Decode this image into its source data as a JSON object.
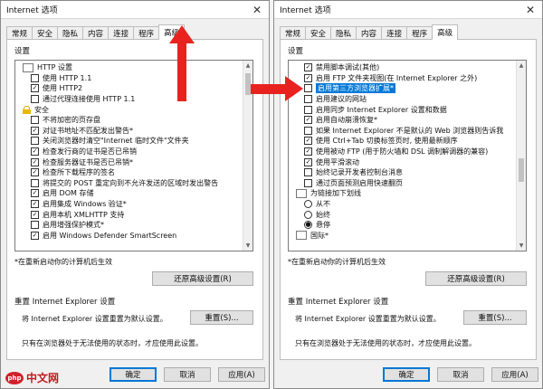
{
  "watermark": {
    "logo": "php",
    "text": "中文网"
  },
  "left": {
    "title": "Internet 选项",
    "tabs": [
      "常规",
      "安全",
      "隐私",
      "内容",
      "连接",
      "程序",
      "高级"
    ],
    "active_tab": 6,
    "settings_label": "设置",
    "rows": [
      {
        "type": "folder",
        "label": "HTTP 设置"
      },
      {
        "type": "check",
        "checked": false,
        "label": "使用 HTTP 1.1"
      },
      {
        "type": "check",
        "checked": true,
        "label": "使用 HTTP2"
      },
      {
        "type": "check",
        "checked": false,
        "label": "通过代理连接使用 HTTP 1.1"
      },
      {
        "type": "lock",
        "label": "安全"
      },
      {
        "type": "check",
        "checked": false,
        "label": "不将加密的页存盘"
      },
      {
        "type": "check",
        "checked": true,
        "label": "对证书地址不匹配发出警告*"
      },
      {
        "type": "check",
        "checked": false,
        "label": "关闭浏览器时清空\"Internet 临时文件\"文件夹"
      },
      {
        "type": "check",
        "checked": true,
        "label": "检查发行商的证书是否已吊销"
      },
      {
        "type": "check",
        "checked": true,
        "label": "检查服务器证书是否已吊销*"
      },
      {
        "type": "check",
        "checked": true,
        "label": "检查所下载程序的签名"
      },
      {
        "type": "check",
        "checked": false,
        "label": "将提交的 POST 重定向到不允许发送的区域时发出警告"
      },
      {
        "type": "check",
        "checked": true,
        "label": "启用 DOM 存储"
      },
      {
        "type": "check",
        "checked": true,
        "label": "启用集成 Windows 验证*"
      },
      {
        "type": "check",
        "checked": true,
        "label": "启用本机 XMLHTTP 支持"
      },
      {
        "type": "check",
        "checked": false,
        "label": "启用增强保护模式*"
      },
      {
        "type": "check",
        "checked": true,
        "label": "启用 Windows Defender SmartScreen"
      }
    ],
    "restart_note": "*在重新启动你的计算机后生效",
    "restore_button": "还原高级设置(R)",
    "reset_group_title": "重置 Internet Explorer 设置",
    "reset_desc": "将 Internet Explorer 设置重置为默认设置。",
    "reset_button": "重置(S)...",
    "reset_note": "只有在浏览器处于无法使用的状态时，才应使用此设置。",
    "ok": "确定",
    "cancel": "取消",
    "apply": "应用(A)"
  },
  "right": {
    "title": "Internet 选项",
    "tabs": [
      "常规",
      "安全",
      "隐私",
      "内容",
      "连接",
      "程序",
      "高级"
    ],
    "active_tab": 6,
    "settings_label": "设置",
    "rows": [
      {
        "type": "check",
        "checked": true,
        "label": "禁用脚本调试(其他)"
      },
      {
        "type": "check",
        "checked": true,
        "label": "启用 FTP 文件夹视图(在 Internet Explorer 之外)"
      },
      {
        "type": "check",
        "checked": false,
        "label": "启用第三方浏览器扩展*",
        "highlight": true
      },
      {
        "type": "check",
        "checked": false,
        "label": "启用建议的网站"
      },
      {
        "type": "check",
        "checked": false,
        "label": "启用同步 Internet Explorer 设置和数据"
      },
      {
        "type": "check",
        "checked": true,
        "label": "启用自动崩溃恢复*"
      },
      {
        "type": "check",
        "checked": false,
        "label": "如果 Internet Explorer 不是默认的 Web 浏览器则告诉我"
      },
      {
        "type": "check",
        "checked": true,
        "label": "使用 Ctrl+Tab 切换标签页时, 使用最新顺序"
      },
      {
        "type": "check",
        "checked": true,
        "label": "使用被动 FTP (用于防火墙和 DSL 调制解调器的兼容)"
      },
      {
        "type": "check",
        "checked": true,
        "label": "使用平滑滚动"
      },
      {
        "type": "check",
        "checked": false,
        "label": "始终记录开发者控制台消息"
      },
      {
        "type": "check",
        "checked": false,
        "label": "通过页面预测启用快速翻页"
      },
      {
        "type": "folder",
        "label": "为链接加下划线"
      },
      {
        "type": "radio",
        "checked": false,
        "label": "从不"
      },
      {
        "type": "radio",
        "checked": false,
        "label": "始终"
      },
      {
        "type": "radio",
        "checked": true,
        "label": "悬停"
      },
      {
        "type": "folder",
        "label": "国际*"
      }
    ],
    "restart_note": "*在重新启动你的计算机后生效",
    "restore_button": "还原高级设置(R)",
    "reset_group_title": "重置 Internet Explorer 设置",
    "reset_desc": "将 Internet Explorer 设置重置为默认设置。",
    "reset_button": "重置(S)...",
    "reset_note": "只有在浏览器处于无法使用的状态时，才应使用此设置。",
    "ok": "确定",
    "cancel": "取消",
    "apply": "应用(A)"
  }
}
